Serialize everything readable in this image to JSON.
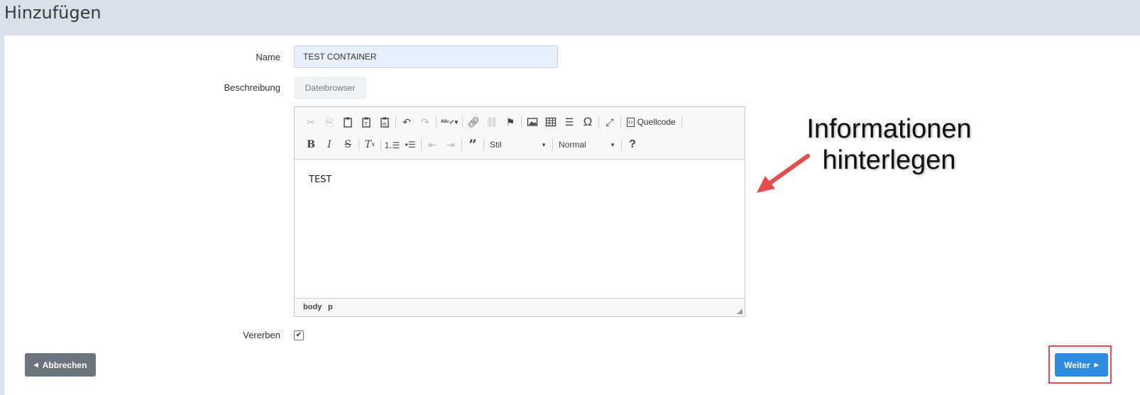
{
  "page": {
    "title": "Hinzufügen"
  },
  "form": {
    "name_label": "Name",
    "name_value": "TEST CONTAINER",
    "description_label": "Beschreibung",
    "file_browser_label": "Dateibrowser",
    "inherit_label": "Vererben",
    "inherit_checked": true
  },
  "editor": {
    "toolbar_row1": [
      "cut-icon",
      "copy-icon",
      "paste-icon",
      "paste-text-icon",
      "paste-word-icon",
      "undo-icon",
      "redo-icon",
      "spellcheck-icon",
      "link-icon",
      "unlink-icon",
      "anchor-icon",
      "image-icon",
      "table-icon",
      "horizontal-rule-icon",
      "special-char-icon",
      "maximize-icon"
    ],
    "source_label": "Quellcode",
    "toolbar_row2": [
      "bold-icon",
      "italic-icon",
      "strike-icon",
      "remove-format-icon",
      "numbered-list-icon",
      "bulleted-list-icon",
      "outdent-icon",
      "indent-icon",
      "blockquote-icon"
    ],
    "style_combo": "Stil",
    "format_combo": "Normal",
    "help_label": "?",
    "content": "TEST",
    "path": [
      "body",
      "p"
    ]
  },
  "buttons": {
    "cancel_label": "Abbrechen",
    "next_label": "Weiter"
  },
  "annotation": {
    "line1": "Informationen",
    "line2": "hinterlegen",
    "color": "#e84b4b"
  }
}
